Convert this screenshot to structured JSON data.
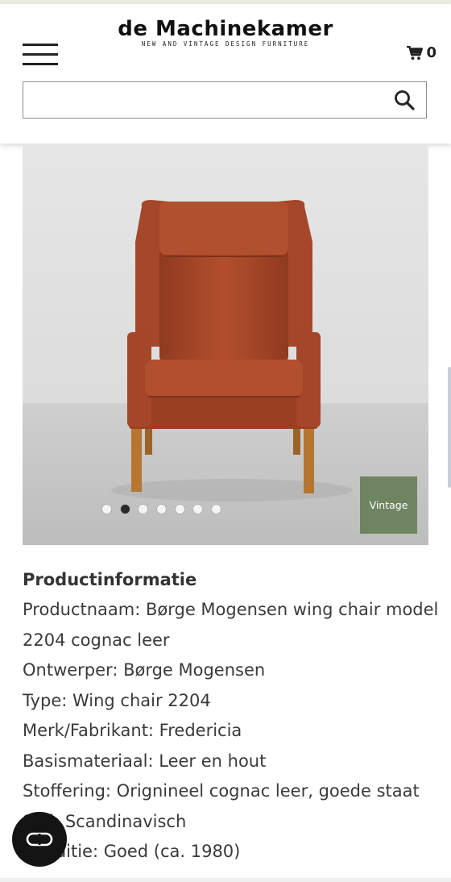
{
  "brand": {
    "name": "de Machinekamer",
    "tagline": "NEW AND VINTAGE DESIGN FURNITURE"
  },
  "header": {
    "menu_icon": "hamburger-menu-icon",
    "cart_icon": "shopping-cart-icon",
    "cart_count": "0"
  },
  "search": {
    "value": "",
    "placeholder": "",
    "icon": "search-icon"
  },
  "gallery": {
    "image": "leather wing chair product photo",
    "slide_count": 7,
    "active_slide": 2,
    "badge": "Vintage"
  },
  "product_info": {
    "heading": "Productinformatie",
    "lines": [
      "Productnaam: Børge Mogensen wing chair model 2204 cognac leer",
      "Ontwerper: Børge Mogensen",
      "Type: Wing chair 2204",
      "Merk/Fabrikant: Fredericia",
      "Basismateriaal: Leer en hout",
      "Stoffering: Orignineel cognac leer, goede staat",
      "Stijl: Scandinavisch",
      "Conditie: Goed (ca. 1980)"
    ]
  },
  "colors": {
    "badge": "#6f8561",
    "header_strip": "#e9ecdc",
    "leather": "#a9492a"
  },
  "chat_button": {
    "icon": "chat-loop-icon"
  }
}
